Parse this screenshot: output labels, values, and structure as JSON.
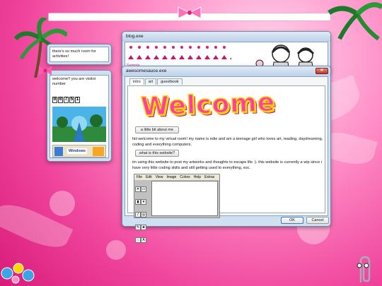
{
  "wall_note": {
    "text": "there's so much room for activities!"
  },
  "visitor": {
    "text": "welcome!! you are visitor number",
    "digits": [
      "0",
      "0",
      "7",
      "5",
      "1"
    ],
    "badge": "Windows"
  },
  "blog": {
    "title": "blog.exe",
    "link": "Sample"
  },
  "main": {
    "title": "awesomesauce.exe",
    "tabs": [
      "intro",
      "art",
      "guestbook"
    ],
    "welcome": "Welcome",
    "btn_about": "a little bit about me",
    "about_text": "hiii welcome to my virtual room! my name is edie and am a teenage girl who loves art, reading, daydreaming, coding and everything computers.",
    "btn_website": "what is this website?",
    "website_text": "im using this website to post my artworks and thoughts to escape life :). this website is currently a wip since i have very little coding skills and still getting used to everything, xoc.",
    "paint_menu": [
      "File",
      "Edit",
      "View",
      "Image",
      "Colors",
      "Help",
      "Extras"
    ],
    "ok": "OK",
    "cancel": "Cancel"
  },
  "colors": {
    "accent": "#e8197c",
    "welcome_fill": "#ff3fa8",
    "welcome_outline": "#ffd800"
  }
}
